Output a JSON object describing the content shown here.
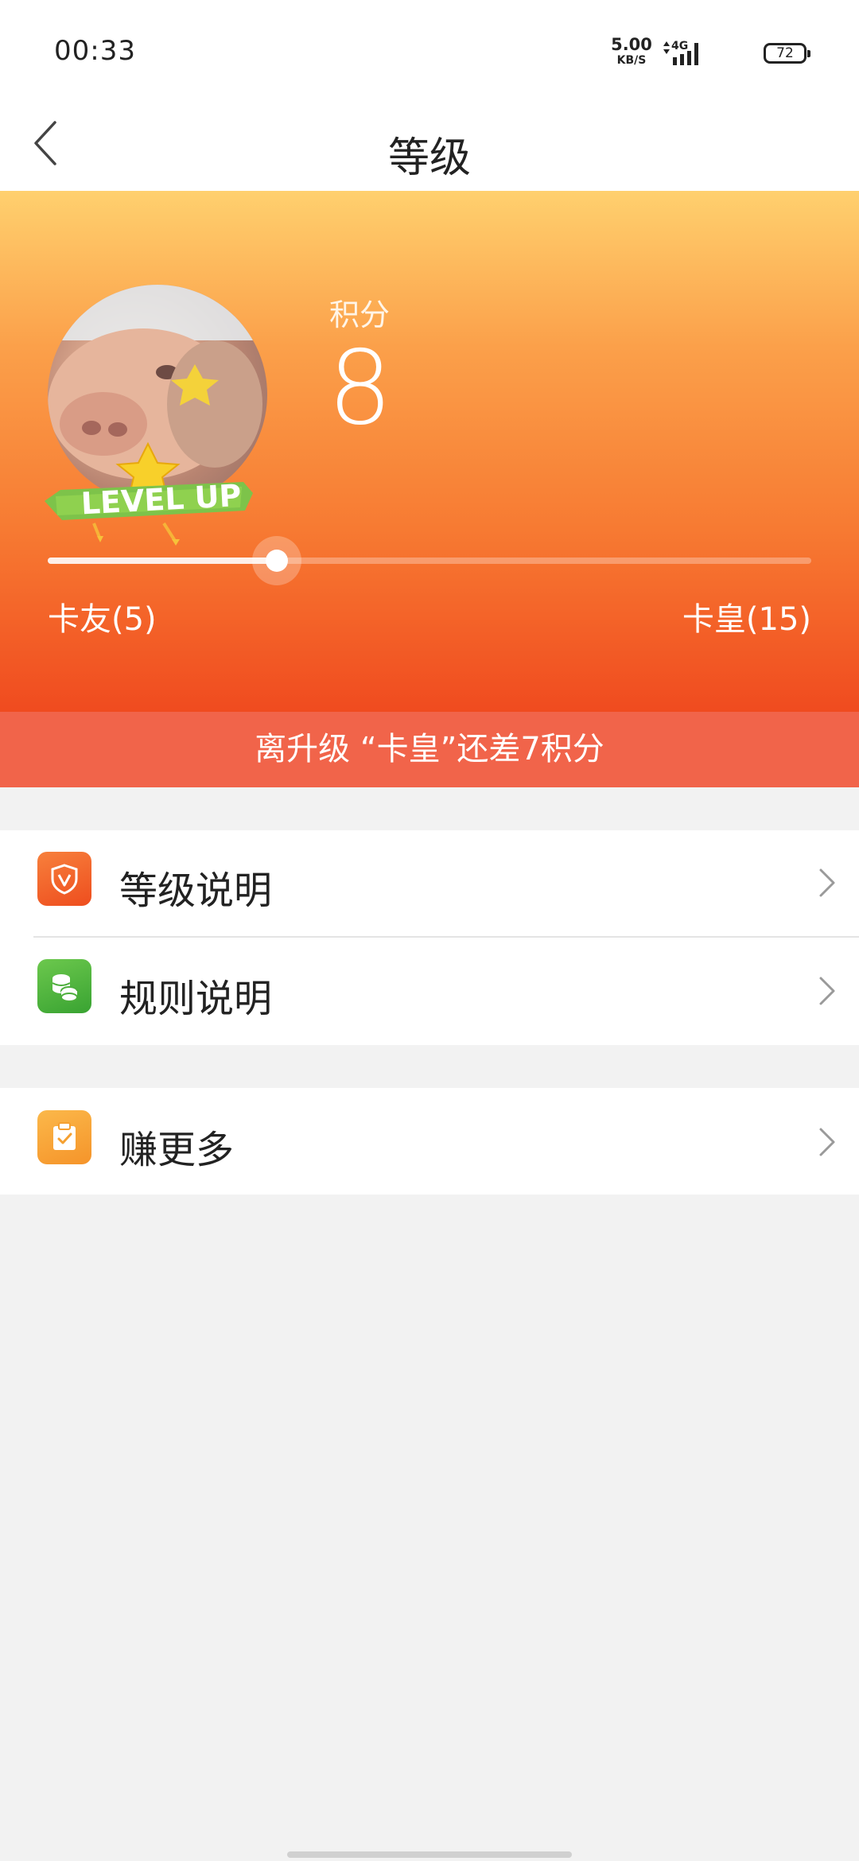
{
  "status_bar": {
    "time": "00:33",
    "net_speed_value": "5.00",
    "net_speed_unit": "KB/S",
    "network": "4G",
    "battery": "72"
  },
  "header": {
    "title": "等级",
    "back_icon": "chevron-left-icon"
  },
  "hero": {
    "badge_text": "LEVEL UP",
    "score_label": "积分",
    "score_value": "8",
    "progress": {
      "current": 8,
      "min": 5,
      "max": 15
    },
    "level_current": "卡友(5)",
    "level_next": "卡皇(15)",
    "colors": {
      "gradient_top": "#ffd06e",
      "gradient_bottom": "#f04b1f"
    }
  },
  "banner": {
    "text": "离升级 “卡皇”还差7积分",
    "color": "#f1644a"
  },
  "menu": {
    "group1": [
      {
        "label": "等级说明",
        "icon": "shield-v-icon",
        "icon_color": "#f05a24"
      },
      {
        "label": "规则说明",
        "icon": "coins-icon",
        "icon_color": "#4caf3c"
      }
    ],
    "group2": [
      {
        "label": "赚更多",
        "icon": "clipboard-check-icon",
        "icon_color": "#f7a12c"
      }
    ]
  }
}
